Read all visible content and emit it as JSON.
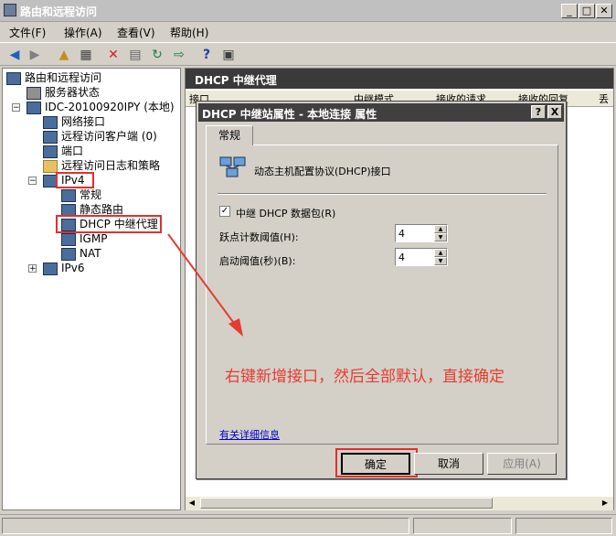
{
  "window": {
    "title": "路由和远程访问"
  },
  "menu": [
    "文件(F)",
    "操作(A)",
    "查看(V)",
    "帮助(H)"
  ],
  "tree": {
    "root": "路由和远程访问",
    "server_status": "服务器状态",
    "server": "IDC-20100920IPY (本地)",
    "network_interfaces": "网络接口",
    "remote_clients": "远程访问客户端 (0)",
    "ports": "端口",
    "logging": "远程访问日志和策略",
    "ipv4": "IPv4",
    "general": "常规",
    "static_routes": "静态路由",
    "dhcp_relay": "DHCP 中继代理",
    "igmp": "IGMP",
    "nat": "NAT",
    "ipv6": "IPv6"
  },
  "right_pane": {
    "header": "DHCP 中继代理",
    "columns": [
      "接口 ",
      "中继模式",
      "接收的请求",
      "接收的回复",
      "丢"
    ]
  },
  "dialog": {
    "title": "DHCP 中继站属性 - 本地连接 属性",
    "help_btn": "?",
    "close_btn": "X",
    "tab": "常规",
    "interface_label": "动态主机配置协议(DHCP)接口",
    "relay_checkbox": "中继 DHCP 数据包(R)",
    "relay_checked": true,
    "hop_label": "跃点计数阈值(H):",
    "hop_value": "4",
    "boot_label": "启动阈值(秒)(B):",
    "boot_value": "4",
    "more_info_link": "有关详细信息",
    "ok": "确定",
    "cancel": "取消",
    "apply": "应用(A)"
  },
  "annotation": {
    "text": "右键新增接口，然后全部默认，直接确定",
    "color": "#e43c30"
  }
}
